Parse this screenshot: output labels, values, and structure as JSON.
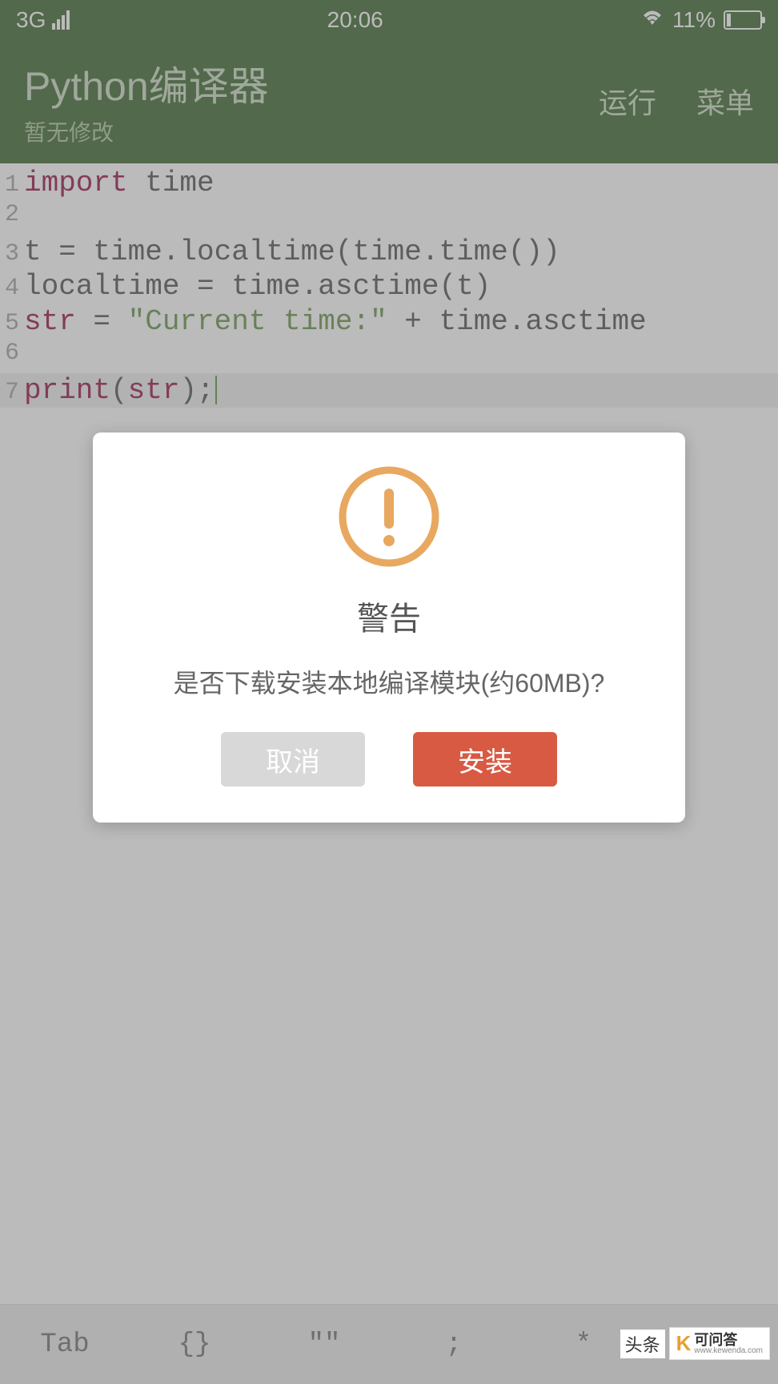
{
  "status_bar": {
    "network": "3G",
    "time": "20:06",
    "battery_percent": "11%"
  },
  "header": {
    "title": "Python编译器",
    "subtitle": "暂无修改",
    "run_label": "运行",
    "menu_label": "菜单"
  },
  "code": {
    "lines": [
      {
        "num": "1",
        "tokens": [
          {
            "t": "import",
            "c": "kw"
          },
          {
            "t": " time",
            "c": "ident"
          }
        ]
      },
      {
        "num": "2",
        "tokens": []
      },
      {
        "num": "3",
        "tokens": [
          {
            "t": "t = time.localtime(time.time())",
            "c": "ident"
          }
        ]
      },
      {
        "num": "4",
        "tokens": [
          {
            "t": "localtime = time.asctime(t)",
            "c": "ident"
          }
        ]
      },
      {
        "num": "5",
        "tokens": [
          {
            "t": "str",
            "c": "kw"
          },
          {
            "t": " = ",
            "c": "ident"
          },
          {
            "t": "\"Current time:\"",
            "c": "str"
          },
          {
            "t": " + time.asctime",
            "c": "ident"
          }
        ]
      },
      {
        "num": "6",
        "tokens": []
      },
      {
        "num": "7",
        "tokens": [
          {
            "t": "print",
            "c": "kw"
          },
          {
            "t": "(",
            "c": "ident"
          },
          {
            "t": "str",
            "c": "kw"
          },
          {
            "t": ");",
            "c": "ident"
          }
        ],
        "current": true
      }
    ]
  },
  "bottom_bar": {
    "keys": [
      "Tab",
      "{}",
      "\"\"",
      ";",
      "*",
      "↺"
    ]
  },
  "modal": {
    "title": "警告",
    "message": "是否下载安装本地编译模块(约60MB)?",
    "cancel_label": "取消",
    "install_label": "安装"
  },
  "watermark": {
    "text1": "头条",
    "logo": "K",
    "brand": "可问答",
    "url": "www.kewenda.com"
  }
}
